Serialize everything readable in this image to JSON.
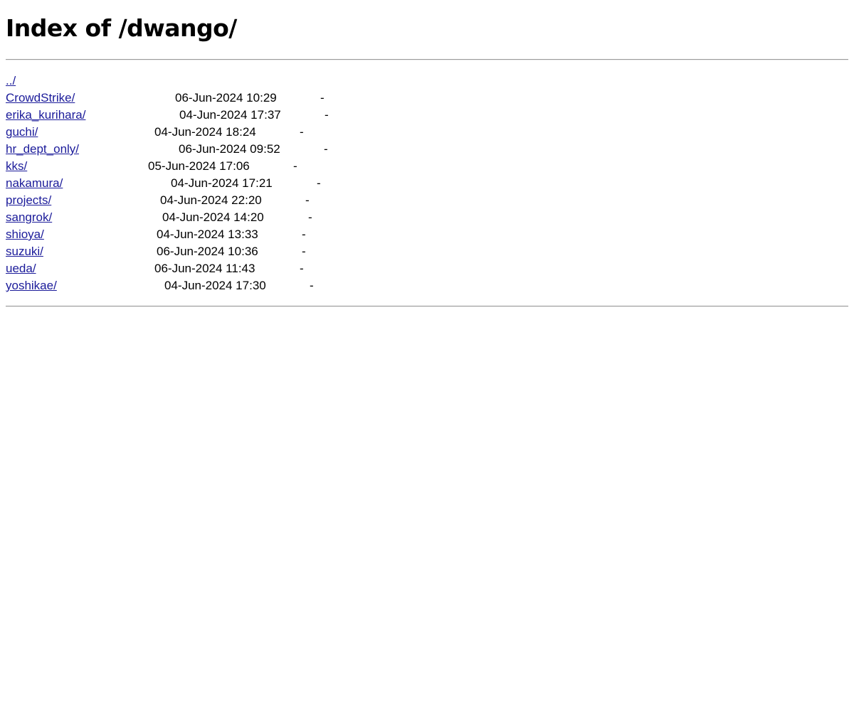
{
  "title": "Index of /dwango/",
  "parent": {
    "label": "../"
  },
  "entries": [
    {
      "name": "CrowdStrike/",
      "modified": "06-Jun-2024 10:29",
      "size": "-"
    },
    {
      "name": "erika_kurihara/",
      "modified": "04-Jun-2024 17:37",
      "size": "-"
    },
    {
      "name": "guchi/",
      "modified": "04-Jun-2024 18:24",
      "size": "-"
    },
    {
      "name": "hr_dept_only/",
      "modified": "06-Jun-2024 09:52",
      "size": "-"
    },
    {
      "name": "kks/",
      "modified": "05-Jun-2024 17:06",
      "size": "-"
    },
    {
      "name": "nakamura/",
      "modified": "04-Jun-2024 17:21",
      "size": "-"
    },
    {
      "name": "projects/",
      "modified": "04-Jun-2024 22:20",
      "size": "-"
    },
    {
      "name": "sangrok/",
      "modified": "04-Jun-2024 14:20",
      "size": "-"
    },
    {
      "name": "shioya/",
      "modified": "04-Jun-2024 13:33",
      "size": "-"
    },
    {
      "name": "suzuki/",
      "modified": "06-Jun-2024 10:36",
      "size": "-"
    },
    {
      "name": "ueda/",
      "modified": "06-Jun-2024 11:43",
      "size": "-"
    },
    {
      "name": "yoshikae/",
      "modified": "04-Jun-2024 17:30",
      "size": "-"
    }
  ]
}
